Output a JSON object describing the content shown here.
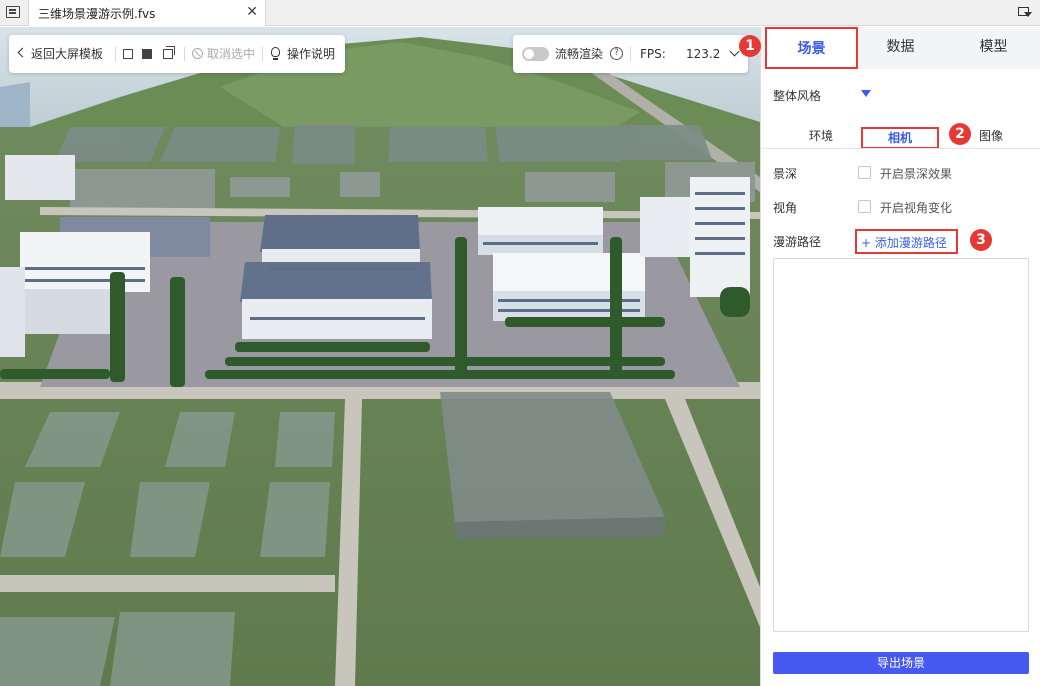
{
  "file_tab": {
    "title": "三维场景漫游示例.fvs",
    "close": "✕"
  },
  "viewport_toolbar": {
    "back_label": "返回大屏模板",
    "cancel_select_label": "取消选中",
    "instructions_label": "操作说明"
  },
  "render_toolbar": {
    "smooth_render_label": "流畅渲染",
    "smooth_render_enabled": false,
    "help_glyph": "?",
    "fps_label": "FPS:",
    "fps_value": "123.2"
  },
  "panel": {
    "tabs": [
      {
        "label": "场景",
        "active": true
      },
      {
        "label": "数据",
        "active": false
      },
      {
        "label": "模型",
        "active": false
      }
    ],
    "overall_style_label": "整体风格",
    "sub_tabs": [
      {
        "label": "环境",
        "active": false
      },
      {
        "label": "相机",
        "active": true
      },
      {
        "label": "图像",
        "active": false
      }
    ],
    "depth_of_field": {
      "label": "景深",
      "checkbox_label": "开启景深效果",
      "checked": false
    },
    "view_angle": {
      "label": "视角",
      "checkbox_label": "开启视角变化",
      "checked": false
    },
    "roam_path": {
      "label": "漫游路径",
      "add_label": "+ 添加漫游路径"
    },
    "export_label": "导出场景"
  },
  "annotations": [
    "1",
    "2",
    "3"
  ],
  "colors": {
    "accent": "#3d5ce6",
    "highlight": "#e53935",
    "export_button": "#4659f0"
  }
}
